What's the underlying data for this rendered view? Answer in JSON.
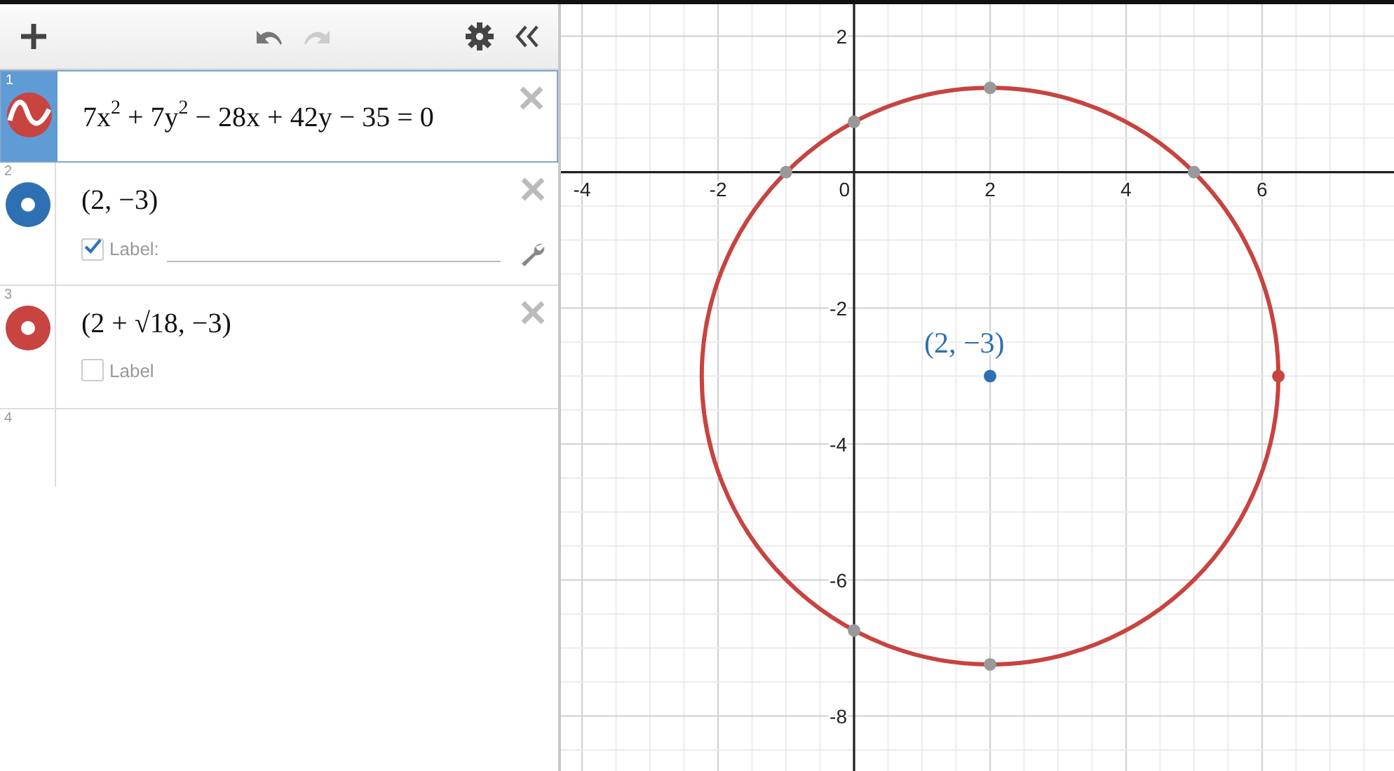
{
  "toolbar": {
    "undo": {
      "disabled": false
    },
    "redo": {
      "disabled": true
    }
  },
  "expressions": [
    {
      "number": "1",
      "kind": "equation",
      "color": "#c74440",
      "selected": true,
      "math": "7x$^{2}$ + 7y$^{2}$ − 28x + 42y − 35 = 0"
    },
    {
      "number": "2",
      "kind": "point",
      "color": "#2d70b3",
      "selected": false,
      "math": "(2, −3)",
      "label": {
        "text": "Label:",
        "checked": true
      }
    },
    {
      "number": "3",
      "kind": "point",
      "color": "#c74440",
      "selected": false,
      "math": "(2 + √18, −3)",
      "label": {
        "text": "Label",
        "checked": false
      }
    },
    {
      "number": "4",
      "kind": "empty",
      "selected": false
    }
  ],
  "graph": {
    "chart_data": {
      "type": "scatter",
      "grid": true,
      "xlim": [
        -4.31,
        7.94
      ],
      "ylim": [
        -8.87,
        2.47
      ],
      "xticks": [
        {
          "value": -4,
          "label": "-4"
        },
        {
          "value": -2,
          "label": "-2"
        },
        {
          "value": 0,
          "label": "0"
        },
        {
          "value": 2,
          "label": "2"
        },
        {
          "value": 4,
          "label": "4"
        },
        {
          "value": 6,
          "label": "6"
        }
      ],
      "yticks": [
        {
          "value": -8,
          "label": "-8"
        },
        {
          "value": -6,
          "label": "-6"
        },
        {
          "value": -4,
          "label": "-4"
        },
        {
          "value": -2,
          "label": "-2"
        },
        {
          "value": 2,
          "label": "2"
        }
      ],
      "series": [
        {
          "type": "scatter",
          "color": "#999999",
          "marker": "circle",
          "x": [
            -1,
            5,
            2,
            2,
            0,
            0
          ],
          "values": [
            0,
            0,
            1.24,
            -7.24,
            0.74,
            -6.74
          ]
        },
        {
          "type": "scatter",
          "color": "#2d70b3",
          "marker": "circle",
          "x": [
            2
          ],
          "values": [
            -3
          ]
        },
        {
          "type": "scatter",
          "color": "#c74440",
          "marker": "circle",
          "x": [
            6.24
          ],
          "values": [
            -3
          ]
        }
      ],
      "annotations": [
        {
          "text": "(2, −3)",
          "x": 2,
          "y": -3
        }
      ]
    }
  }
}
